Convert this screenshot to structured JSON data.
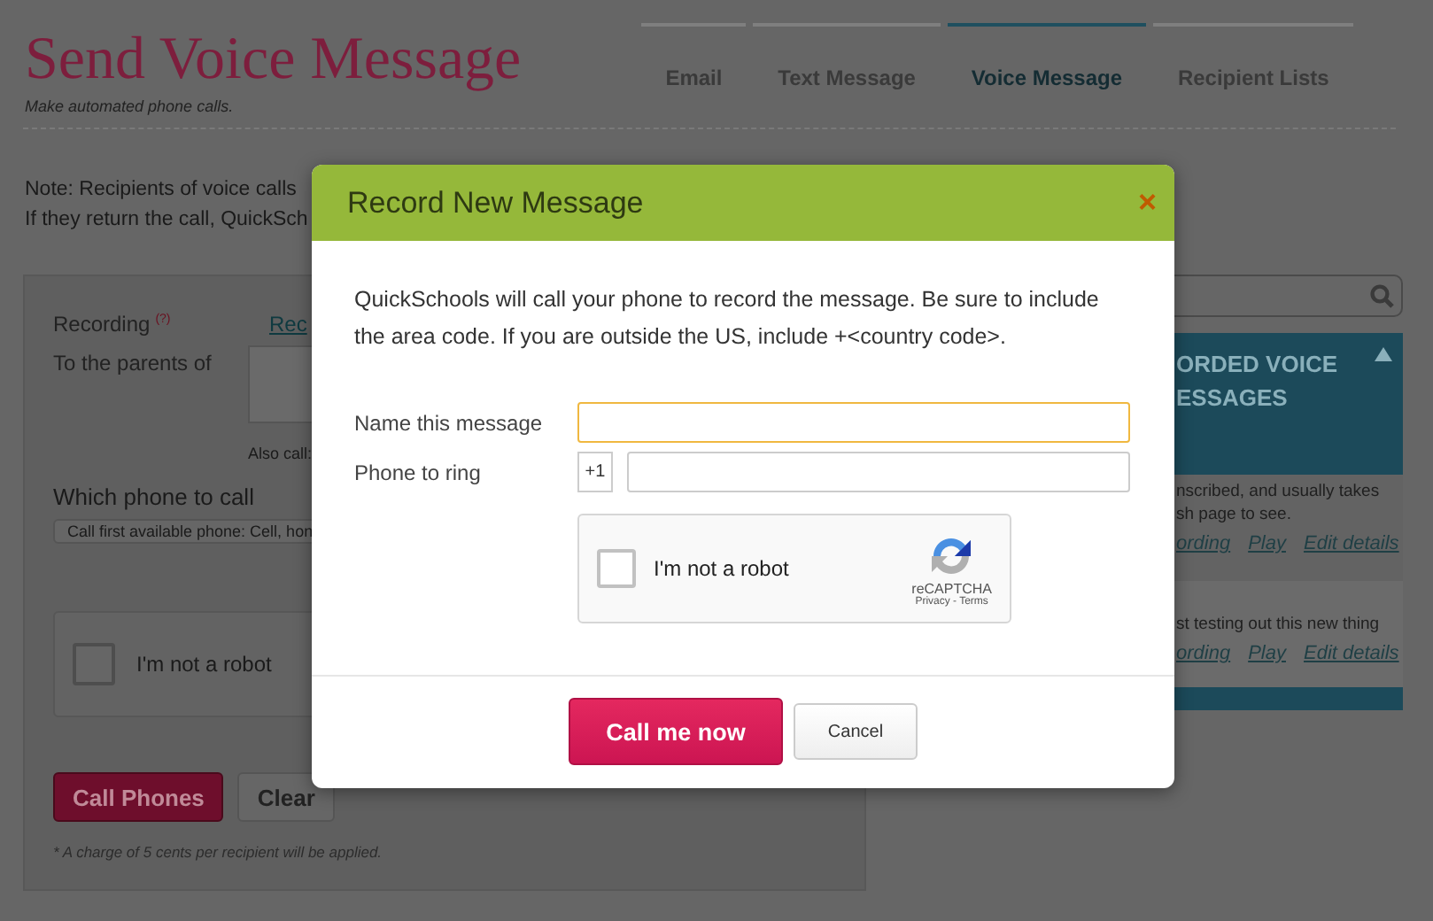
{
  "header": {
    "title": "Send Voice Message",
    "subtitle": "Make automated phone calls."
  },
  "tabs": [
    {
      "label": "Email",
      "selected": false
    },
    {
      "label": "Text Message",
      "selected": false
    },
    {
      "label": "Voice Message",
      "selected": true
    },
    {
      "label": "Recipient Lists",
      "selected": false
    }
  ],
  "note": [
    "Note: Recipients of voice calls",
    "If they return the call, QuickSch"
  ],
  "form": {
    "recording_label": "Recording",
    "help_mark": "(?)",
    "recording_link": "Rec",
    "parents_label": "To the parents of",
    "also_call": "Also call:",
    "phone_label": "Which phone to call",
    "phone_select": "Call first available phone: Cell, hon",
    "captcha": {
      "label": "I'm not a robot",
      "checked": false
    },
    "buttons": [
      {
        "label": "Call Phones",
        "kind": "primary"
      },
      {
        "label": "Clear",
        "kind": "secondary"
      }
    ],
    "footnote": "* A charge of 5 cents per recipient will be applied."
  },
  "recordings": {
    "title_lines": [
      "ORDED VOICE",
      "ESSAGES"
    ],
    "expanded": true,
    "items": [
      {
        "text_lines": [
          "nscribed, and usually takes",
          "sh page to see."
        ],
        "links": [
          "ording",
          "Play",
          "Edit details"
        ]
      },
      {
        "text_lines": [
          "st testing out this new thing"
        ],
        "links": [
          "ording",
          "Play",
          "Edit details"
        ]
      }
    ]
  },
  "dialog": {
    "title": "Record New Message",
    "close": "×",
    "intro": "QuickSchools will call your phone to record the message. Be sure to include the area code. If you are outside the US, include +<country code>.",
    "fields": [
      {
        "kind": "text",
        "label": "Name this message",
        "focused": true
      },
      {
        "kind": "phone",
        "label": "Phone to ring",
        "prefix": "+1",
        "focused": false
      }
    ],
    "captcha": {
      "label": "I'm not a robot",
      "checked": false,
      "brand": "reCAPTCHA",
      "links": "Privacy - Terms"
    },
    "buttons": [
      {
        "label": "Call me now",
        "kind": "primary"
      },
      {
        "label": "Cancel",
        "kind": "secondary"
      }
    ]
  }
}
